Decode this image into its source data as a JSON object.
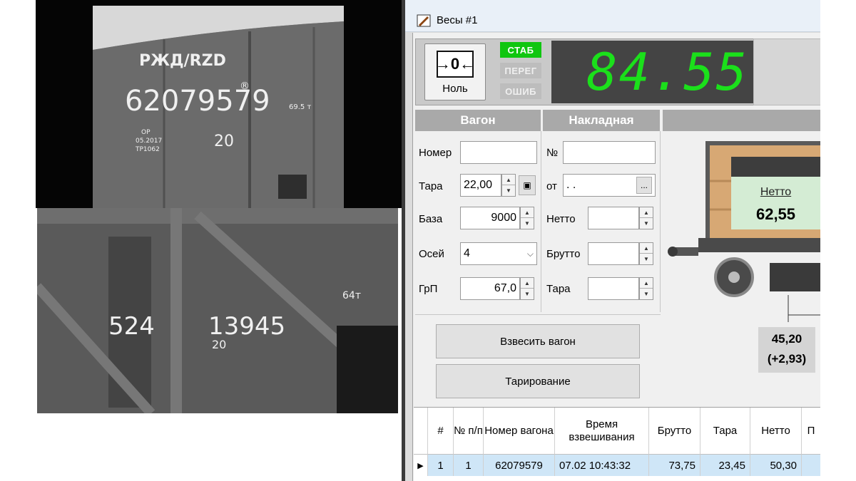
{
  "cameras": {
    "cam1": {
      "mark": "РЖД/RZD",
      "number": "62079579",
      "superscript": "®",
      "stencil_lines": [
        "ОР",
        "05.2017",
        "ТР1062"
      ],
      "axles": "20",
      "capacity": "69.5 т"
    },
    "cam2": {
      "prefix": "524",
      "number": "13945",
      "sub": "20",
      "capacity": "64т"
    }
  },
  "window": {
    "title": "Весы #1",
    "icon": "scale-app-icon"
  },
  "scale": {
    "zero_button": {
      "icon_text": "→0←",
      "label": "Ноль"
    },
    "indicators": [
      {
        "label": "СТАБ",
        "active": true,
        "color": "#10c610"
      },
      {
        "label": "ПЕРЕГ",
        "active": false
      },
      {
        "label": "ОШИБ",
        "active": false
      }
    ],
    "display_value": "84.55",
    "display_color": "#1be01b"
  },
  "wagon": {
    "header": "Вагон",
    "number_label": "Номер",
    "number_value": "",
    "tara_label": "Тара",
    "tara_value": "22,00",
    "base_label": "База",
    "base_value": "9000",
    "axles_label": "Осей",
    "axles_value": "4",
    "grp_label": "ГрП",
    "grp_value": "67,0"
  },
  "waybill": {
    "header": "Накладная",
    "no_label": "№",
    "no_value": "",
    "from_label": "от",
    "from_value": ". .",
    "from_button": "...",
    "netto_label": "Нетто",
    "netto_value": "",
    "brutto_label": "Брутто",
    "brutto_value": "",
    "tara_label": "Тара",
    "tara_value": ""
  },
  "actions": {
    "weigh_button": "Взвесить вагон",
    "tare_button": "Тарирование"
  },
  "diagram": {
    "netto_label": "Нетто",
    "netto_value": "62,55",
    "axle_load": "45,20",
    "axle_delta": "(+2,93)"
  },
  "table": {
    "headers": [
      "#",
      "№ п/п",
      "Номер вагона",
      "Время взвешивания",
      "Брутто",
      "Тара",
      "Нетто",
      "П"
    ],
    "rows": [
      {
        "marker": "▶",
        "index": "1",
        "pp": "1",
        "wagon": "62079579",
        "time": "07.02 10:43:32",
        "brutto": "73,75",
        "tara": "23,45",
        "netto": "50,30"
      }
    ]
  }
}
